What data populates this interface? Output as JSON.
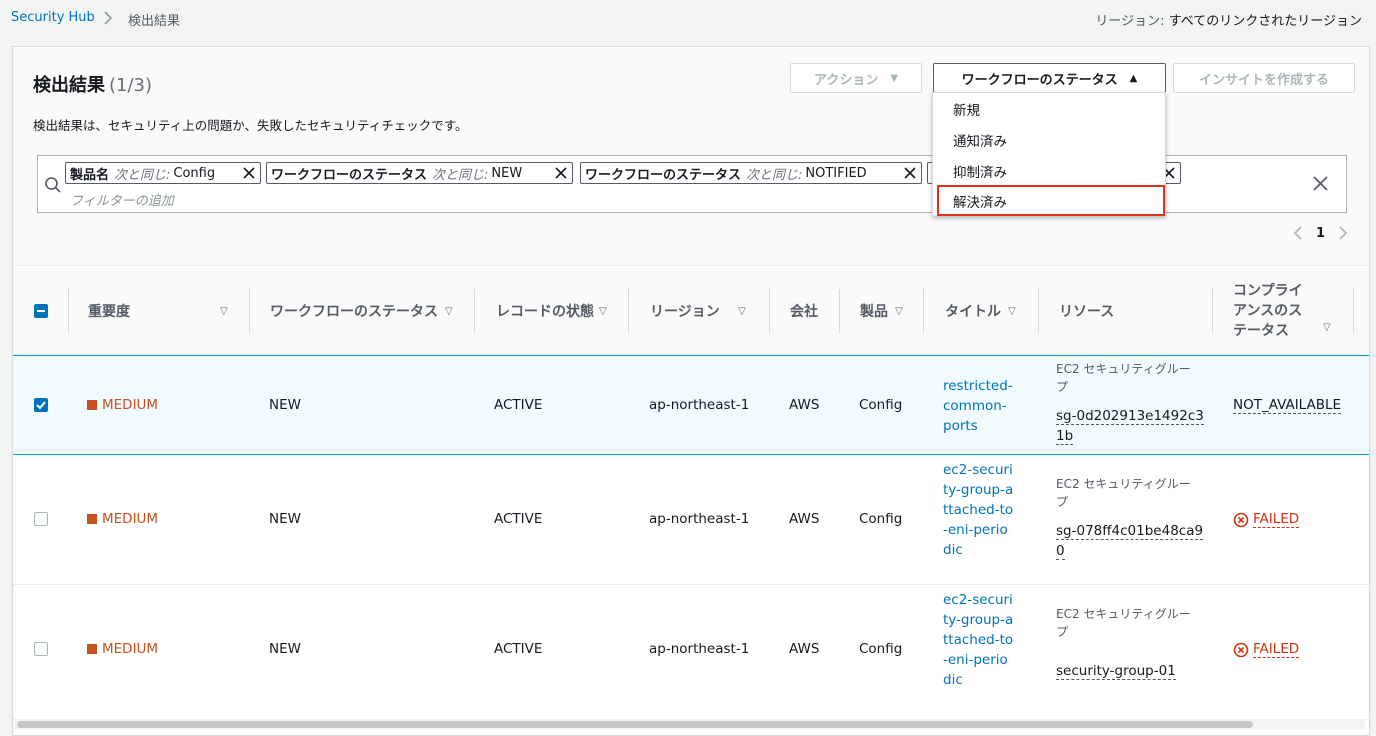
{
  "breadcrumb": {
    "root": "Security Hub",
    "current": "検出結果"
  },
  "region": {
    "label": "リージョン:",
    "value": "すべてのリンクされたリージョン"
  },
  "header": {
    "title": "検出結果",
    "count": "(1/3)",
    "description": "検出結果は、セキュリティ上の問題か、失敗したセキュリティチェックです。",
    "action_button": "アクション",
    "workflow_button": "ワークフローのステータス",
    "insight_button": "インサイトを作成する"
  },
  "filters": {
    "tokens": [
      {
        "key": "製品名",
        "op": "次と同じ:",
        "value": "Config"
      },
      {
        "key": "ワークフローのステータス",
        "op": "次と同じ:",
        "value": "NEW"
      },
      {
        "key": "ワークフローのステータス",
        "op": "次と同じ:",
        "value": "NOTIFIED"
      }
    ],
    "placeholder": "フィルターの追加"
  },
  "pagination": {
    "page": "1"
  },
  "workflow_menu": {
    "items": [
      "新規",
      "通知済み",
      "抑制済み",
      "解決済み"
    ],
    "highlighted": "解決済み"
  },
  "table": {
    "columns": {
      "severity": "重要度",
      "workflow": "ワークフローのステータス",
      "record": "レコードの状態",
      "region": "リージョン",
      "company": "会社",
      "product": "製品",
      "title": "タイトル",
      "resource": "リソース",
      "compliance": "コンプライアンスのステータス"
    },
    "rows": [
      {
        "selected": true,
        "severity": "MEDIUM",
        "workflow": "NEW",
        "record": "ACTIVE",
        "region": "ap-northeast-1",
        "company": "AWS",
        "product": "Config",
        "title": "restricted-common-ports",
        "resource_type": "EC2 セキュリティグループ",
        "resource_id": "sg-0d202913e1492c31b",
        "compliance": "NOT_AVAILABLE"
      },
      {
        "selected": false,
        "severity": "MEDIUM",
        "workflow": "NEW",
        "record": "ACTIVE",
        "region": "ap-northeast-1",
        "company": "AWS",
        "product": "Config",
        "title": "ec2-security-group-attached-to-eni-periodic",
        "resource_type": "EC2 セキュリティグループ",
        "resource_id": "sg-078ff4c01be48ca90",
        "compliance": "FAILED"
      },
      {
        "selected": false,
        "severity": "MEDIUM",
        "workflow": "NEW",
        "record": "ACTIVE",
        "region": "ap-northeast-1",
        "company": "AWS",
        "product": "Config",
        "title": "ec2-security-group-attached-to-eni-periodic",
        "resource_type": "EC2 セキュリティグループ",
        "resource_id": "security-group-01",
        "compliance": "FAILED"
      }
    ]
  },
  "colors": {
    "link": "#0073bb",
    "medium": "#c7511f",
    "failed": "#d13212",
    "highlight_border": "#e5321b"
  }
}
